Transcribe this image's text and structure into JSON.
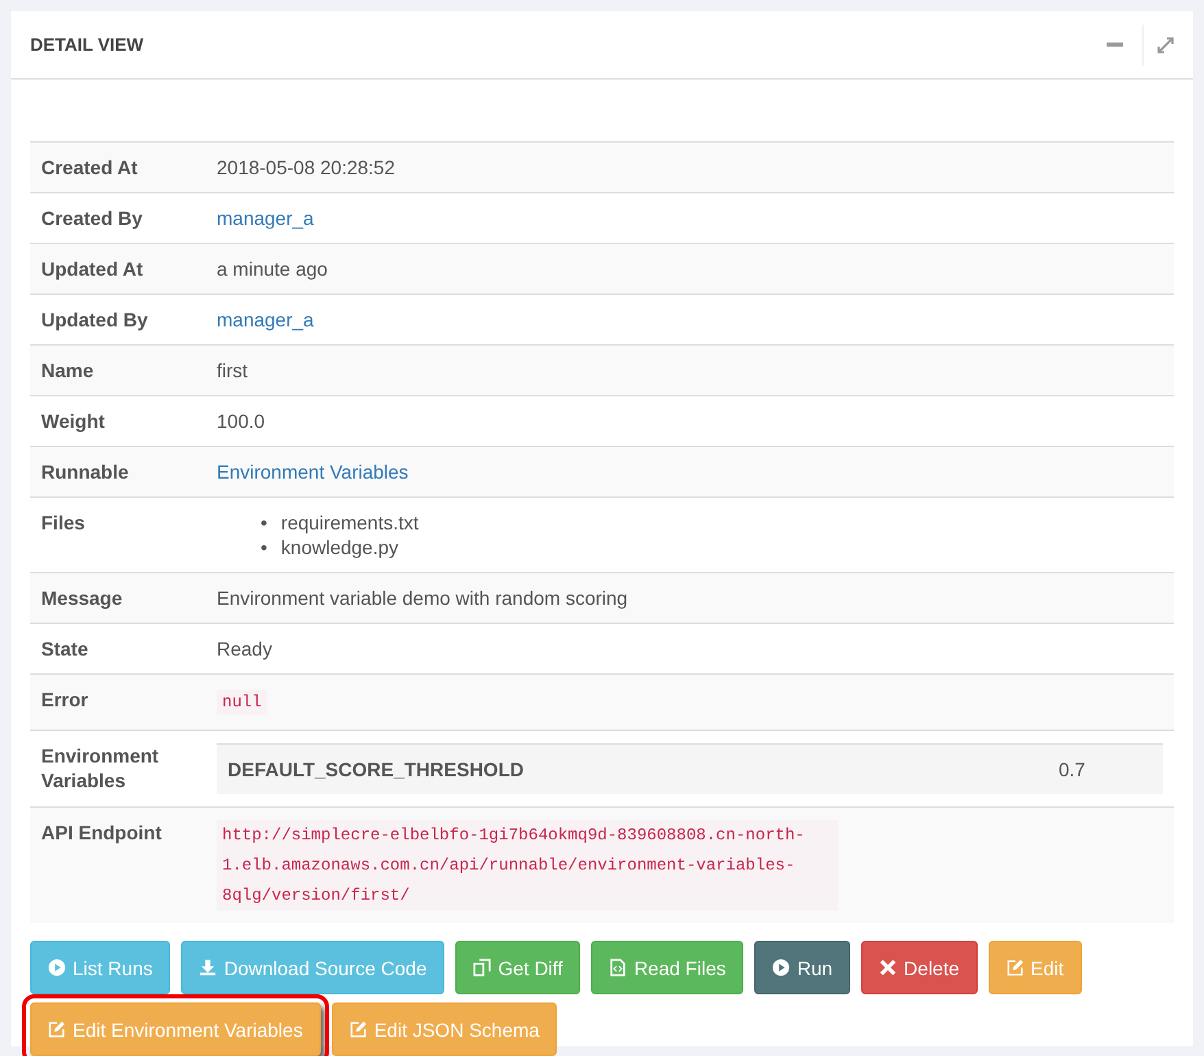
{
  "panel": {
    "title": "DETAIL VIEW"
  },
  "rows": [
    {
      "label": "Created At",
      "kind": "text",
      "value": "2018-05-08 20:28:52"
    },
    {
      "label": "Created By",
      "kind": "link",
      "value": "manager_a"
    },
    {
      "label": "Updated At",
      "kind": "text",
      "value": "a minute ago"
    },
    {
      "label": "Updated By",
      "kind": "link",
      "value": "manager_a"
    },
    {
      "label": "Name",
      "kind": "text",
      "value": "first"
    },
    {
      "label": "Weight",
      "kind": "text",
      "value": "100.0"
    },
    {
      "label": "Runnable",
      "kind": "link",
      "value": "Environment Variables"
    },
    {
      "label": "Files",
      "kind": "list",
      "bullet": "•",
      "items": [
        "requirements.txt",
        "knowledge.py"
      ]
    },
    {
      "label": "Message",
      "kind": "text",
      "value": "Environment variable demo with random scoring"
    },
    {
      "label": "State",
      "kind": "text",
      "value": "Ready"
    },
    {
      "label": "Error",
      "kind": "code",
      "value": "null"
    },
    {
      "label": "Environment Variables",
      "kind": "pairs",
      "pairs": [
        {
          "key": "DEFAULT_SCORE_THRESHOLD",
          "value": "0.7"
        }
      ]
    },
    {
      "label": "API Endpoint",
      "kind": "code",
      "value": "http://simplecre-elbelbfo-1gi7b64okmq9d-839608808.cn-north-1.elb.amazonaws.com.cn/api/runnable/environment-variables-8qlg/version/first/"
    }
  ],
  "buttons": [
    {
      "label": "List Runs",
      "kind": "info",
      "highlighted": false
    },
    {
      "label": "Download Source Code",
      "kind": "info",
      "highlighted": false
    },
    {
      "label": "Get Diff",
      "kind": "success",
      "highlighted": false
    },
    {
      "label": "Read Files",
      "kind": "success",
      "highlighted": false
    },
    {
      "label": "Run",
      "kind": "dark",
      "highlighted": false
    },
    {
      "label": "Delete",
      "kind": "danger",
      "highlighted": false
    },
    {
      "label": "Edit",
      "kind": "warning",
      "highlighted": false
    },
    {
      "label": "Edit Environment Variables",
      "kind": "warning",
      "highlighted": true
    },
    {
      "label": "Edit JSON Schema",
      "kind": "warning",
      "highlighted": false
    }
  ]
}
